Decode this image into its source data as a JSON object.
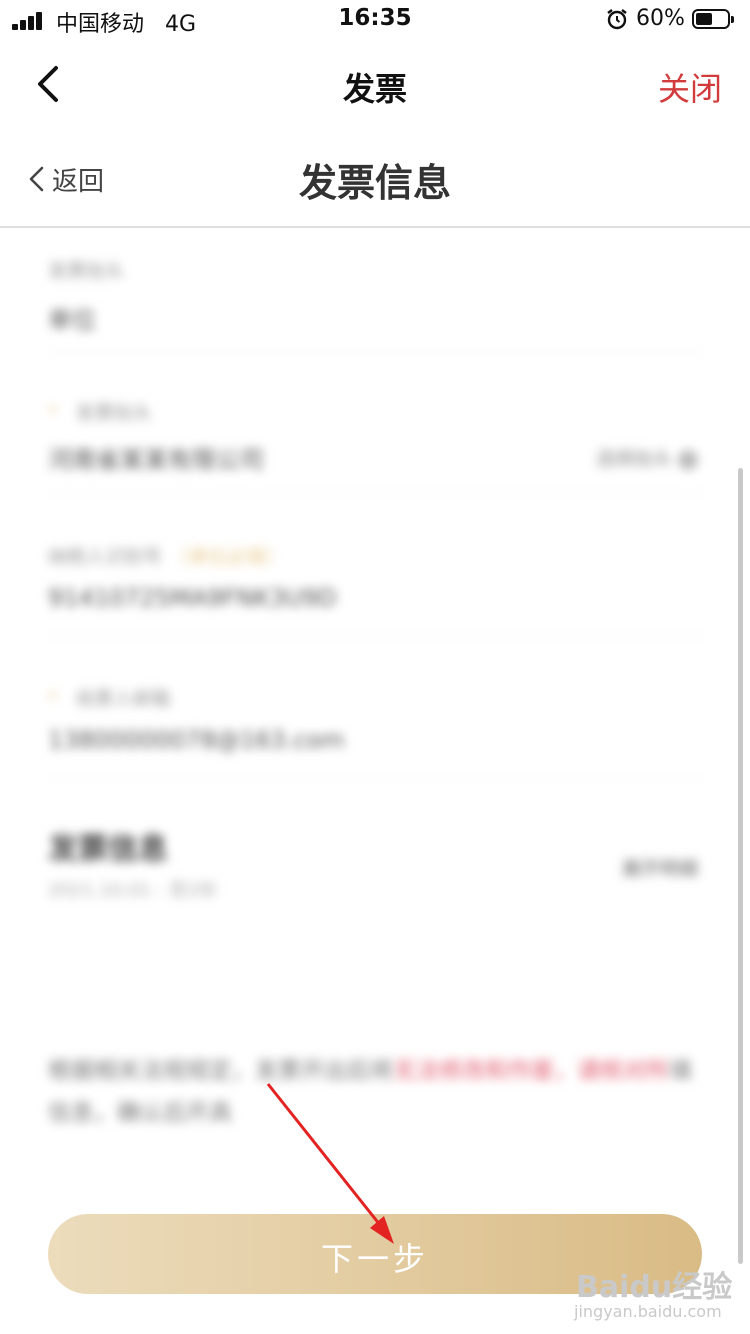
{
  "status_bar": {
    "carrier": "中国移动",
    "network": "4G",
    "time": "16:35",
    "battery_percent": "60%",
    "battery_level": 0.6,
    "icons": [
      "signal-icon",
      "alarm-icon",
      "battery-icon"
    ]
  },
  "nav": {
    "back_icon": "chevron-left-icon",
    "title": "发票",
    "close_label": "关闭",
    "close_color": "#d23b3b"
  },
  "sub_header": {
    "back_label": "返回",
    "title": "发票信息"
  },
  "form": {
    "fields": [
      {
        "label": "发票抬头",
        "value": "单位"
      },
      {
        "label": "发票抬头",
        "value": "河南省某某有限公司",
        "right": "选择抬头"
      },
      {
        "label": "纳税人识别号",
        "note": "（单位必填）",
        "value": "91410725MA9FNK3U9D"
      },
      {
        "label": "收票人邮箱",
        "value": "13800000078@163.com"
      }
    ],
    "section": {
      "title": "发票信息",
      "subtitle": "2021.10.01 - 至2份",
      "right": "展开明细"
    },
    "notice": {
      "text": "根据相关法规规定，发票开出后将",
      "highlight": "无法修改和作废，请核对所",
      "text2": "填信息，确认后开具"
    }
  },
  "next_button": {
    "label": "下一步",
    "gradient": [
      "#ecdcbc",
      "#d9bb85"
    ]
  },
  "annotation": {
    "arrow_color": "#e32222"
  },
  "watermark": {
    "logo": "Baidu经验",
    "sub": "jingyan.baidu.com"
  }
}
